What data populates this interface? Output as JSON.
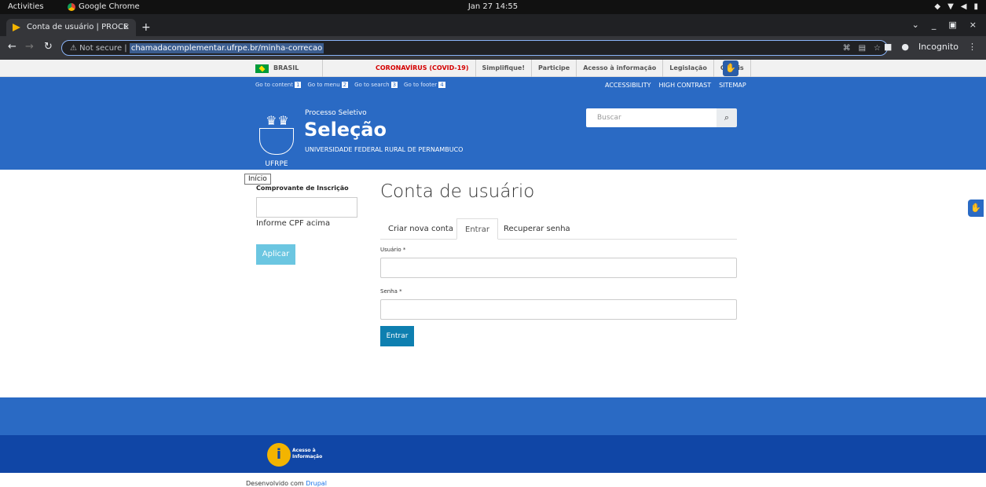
{
  "os": {
    "activities": "Activities",
    "app_name": "Google Chrome",
    "clock": "Jan 27  14:55"
  },
  "browser": {
    "tab_title": "Conta de usuário | PROCE",
    "tab_close": "×",
    "new_tab": "+",
    "security_label": "Not secure",
    "url": "chamadacomplementar.ufrpe.br/minha-correcao",
    "profile_label": "Incognito"
  },
  "govbar": {
    "country": "BRASIL",
    "links": [
      "CORONAVÍRUS (COVID-19)",
      "Simplifique!",
      "Participe",
      "Acesso à informação",
      "Legislação",
      "Canais"
    ]
  },
  "header": {
    "skip_links": [
      {
        "label": "Go to content",
        "key": "1"
      },
      {
        "label": "Go to menu",
        "key": "2"
      },
      {
        "label": "Go to search",
        "key": "3"
      },
      {
        "label": "Go to footer",
        "key": "4"
      }
    ],
    "accessibility_links": [
      "ACCESSIBILITY",
      "HIGH CONTRAST",
      "SITEMAP"
    ],
    "subtitle": "Processo Seletivo",
    "title": "Seleção",
    "university": "UNIVERSIDADE FEDERAL RURAL DE PERNAMBUCO",
    "logo_text": "UFRPE",
    "search_placeholder": "Buscar"
  },
  "sidebar": {
    "tooltip": "Início",
    "label": "Comprovante de Inscrição",
    "help": "Informe CPF acima",
    "apply": "Aplicar"
  },
  "main": {
    "title": "Conta de usuário",
    "tabs": [
      "Criar nova conta",
      "Entrar",
      "Recuperar senha"
    ],
    "username_label": "Usuário *",
    "password_label": "Senha *",
    "submit": "Entrar"
  },
  "footer": {
    "access_info": "Acesso à",
    "access_info2": "Informação",
    "developed_prefix": "Desenvolvido com",
    "developed_link": "Drupal"
  }
}
